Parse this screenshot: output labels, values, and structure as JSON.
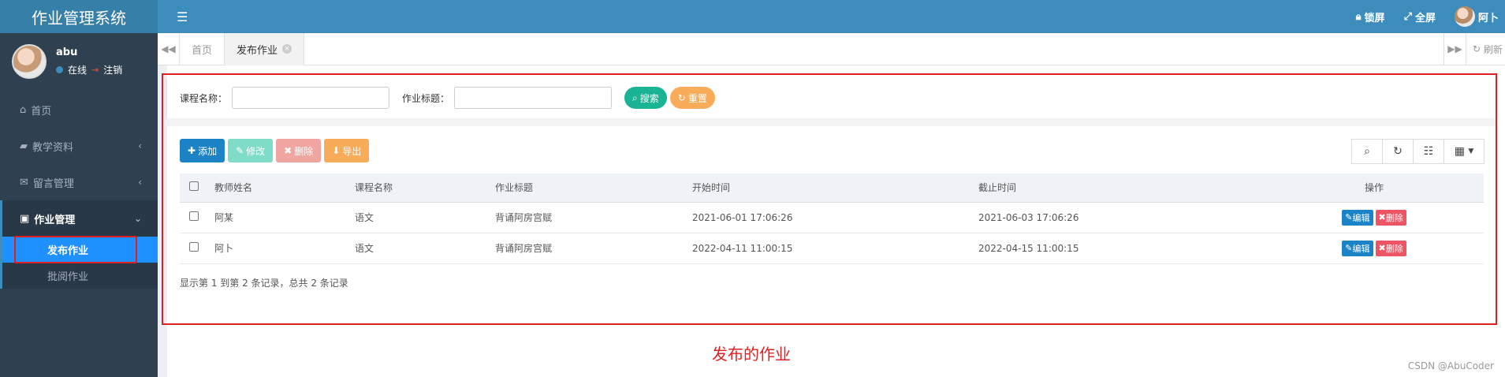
{
  "sidebar": {
    "brand": "作业管理系统",
    "user": {
      "name": "abu",
      "status": "在线",
      "logout": "注销"
    },
    "items": [
      {
        "label": "首页",
        "icon": "home-icon"
      },
      {
        "label": "教学资料",
        "icon": "folder-icon"
      },
      {
        "label": "留言管理",
        "icon": "mail-icon"
      },
      {
        "label": "作业管理",
        "icon": "id-card-icon"
      }
    ],
    "sub_items": [
      {
        "label": "发布作业"
      },
      {
        "label": "批阅作业"
      }
    ]
  },
  "header": {
    "lock_label": "锁屏",
    "fullscreen_label": "全屏",
    "user_name": "阿卜"
  },
  "tabs": {
    "items": [
      {
        "label": "首页"
      },
      {
        "label": "发布作业"
      }
    ],
    "refresh_label": "刷新"
  },
  "search": {
    "course_label": "课程名称：",
    "title_label": "作业标题：",
    "course_value": "",
    "title_value": "",
    "search_button": "搜索",
    "reset_button": "重置"
  },
  "toolbar": {
    "add": "添加",
    "edit": "修改",
    "delete": "删除",
    "export": "导出"
  },
  "table": {
    "columns": [
      "教师姓名",
      "课程名称",
      "作业标题",
      "开始时间",
      "截止时间",
      "操作"
    ],
    "rows": [
      {
        "teacher": "阿某",
        "course": "语文",
        "title": "背诵阿房宫赋",
        "start": "2021-06-01 17:06:26",
        "end": "2021-06-03 17:06:26"
      },
      {
        "teacher": "阿卜",
        "course": "语文",
        "title": "背诵阿房宫赋",
        "start": "2022-04-11 11:00:15",
        "end": "2022-04-15 11:00:15"
      }
    ],
    "row_edit": "编辑",
    "row_delete": "删除"
  },
  "pagination": {
    "summary": "显示第 1 到第 2 条记录，总共 2 条记录"
  },
  "annotation": {
    "caption": "发布的作业"
  },
  "watermark": "CSDN @AbuCoder",
  "colors": {
    "header": "#3c8dbc",
    "sidebar": "#2f4050",
    "accent_red": "#e02020"
  }
}
